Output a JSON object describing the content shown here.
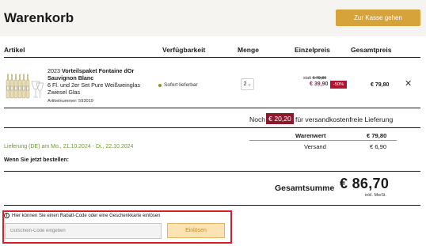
{
  "header": {
    "title": "Warenkorb",
    "checkout_label": "Zur Kasse gehen"
  },
  "columns": {
    "artikel": "Artikel",
    "verfuegbarkeit": "Verfügbarkeit",
    "menge": "Menge",
    "einzelpreis": "Einzelpreis",
    "gesamtpreis": "Gesamtpreis"
  },
  "item": {
    "year": "2023",
    "name": "Vorteilspaket Fontaine dOr Sauvignon Blanc",
    "description": "6 Fl. und 2er Set Pure Weißweinglas Zwiesel Glas",
    "article_number": "Artikelnummer: 593019",
    "availability": "Sofort lieferbar",
    "quantity": "2",
    "old_price_prefix": "statt",
    "old_price": "€ 79,80",
    "price": "€ 39,90",
    "discount": "-50%",
    "total": "€ 79,80",
    "remove_icon": "close-icon"
  },
  "shipping": {
    "prefix": "Noch",
    "amount": "€ 20,20",
    "suffix": "für versandkostenfreie Lieferung"
  },
  "delivery": {
    "text": "Lieferung (DE) am Mo., 21.10.2024 - Di., 22.10.2024",
    "order_now": "Wenn Sie jetzt bestellen:"
  },
  "summary": {
    "warenwert_label": "Warenwert",
    "warenwert_value": "€ 79,80",
    "versand_label": "Versand",
    "versand_value": "€ 6,90",
    "total_label": "Gesamtsumme",
    "total_value": "€ 86,70",
    "vat_note": "inkl. MwSt."
  },
  "voucher": {
    "info": "Hier können Sie einen Rabatt-Code oder eine Geschenkkarte einlösen",
    "placeholder": "Gutschein-Code eingeben",
    "button": "Einlösen"
  },
  "colors": {
    "accent": "#d6a23a",
    "sale": "#c0143c",
    "shipping_badge": "#8a1a2e",
    "delivery": "#6e9a2c",
    "highlight_border": "#d61f2a"
  }
}
